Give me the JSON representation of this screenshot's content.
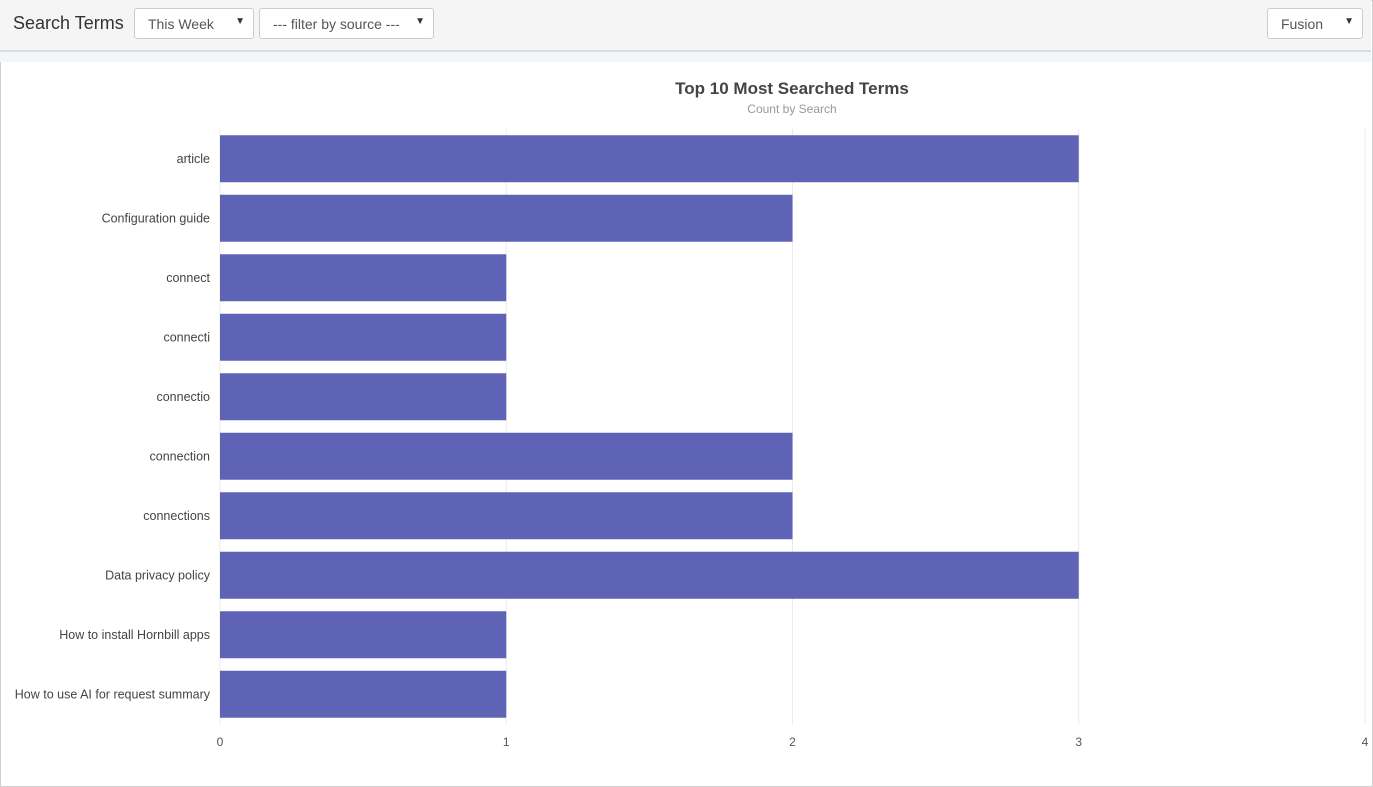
{
  "header": {
    "title": "Search Terms",
    "period": "This Week",
    "source": "--- filter by source ---",
    "engine": "Fusion"
  },
  "chart_data": {
    "type": "bar",
    "orientation": "horizontal",
    "title": "Top 10 Most Searched Terms",
    "subtitle": "Count by Search",
    "categories": [
      "article",
      "Configuration guide",
      "connect",
      "connecti",
      "connectio",
      "connection",
      "connections",
      "Data privacy policy",
      "How to install Hornbill apps",
      "How to use AI for request summary"
    ],
    "values": [
      3,
      2,
      1,
      1,
      1,
      2,
      2,
      3,
      1,
      1
    ],
    "xlim": [
      0,
      4
    ],
    "xticks": [
      "0",
      "1",
      "2",
      "3",
      "4"
    ],
    "color": "#5e63b6",
    "grid": true
  }
}
